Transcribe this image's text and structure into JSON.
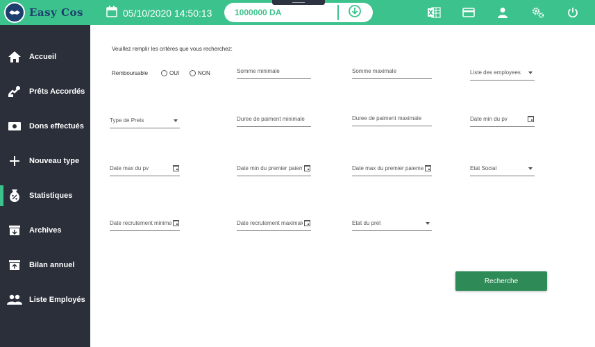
{
  "header": {
    "logo_text": "Easy Cos",
    "datetime": "05/10/2020 14:50:13",
    "balance": "1000000 DA",
    "icons": [
      "excel-icon",
      "credit-card-icon",
      "user-icon",
      "settings-icon",
      "power-icon"
    ]
  },
  "sidebar": {
    "items": [
      {
        "label": "Accueil",
        "icon": "home-icon"
      },
      {
        "label": "Prêts Accordés",
        "icon": "loan-icon"
      },
      {
        "label": "Dons effectués",
        "icon": "money-icon"
      },
      {
        "label": "Nouveau type",
        "icon": "plus-icon"
      },
      {
        "label": "Statistiques",
        "icon": "stats-icon"
      },
      {
        "label": "Archives",
        "icon": "archive-icon"
      },
      {
        "label": "Bilan annuel",
        "icon": "bilan-icon"
      },
      {
        "label": "Liste Employés",
        "icon": "people-icon"
      }
    ],
    "active_index": 4
  },
  "form": {
    "intro": "Veuillez remplir les critères que vous recherchez:",
    "remboursable_label": "Remboursable",
    "radio_oui": "OUI",
    "radio_non": "NON",
    "somme_min": "Somme minimale",
    "somme_max": "Somme maximale",
    "liste_employes": "Liste des employees",
    "type_prets": "Type de Prets",
    "duree_min": "Duree de paiment minimale",
    "duree_max": "Duree de paiment maximale",
    "date_min_pv": "Date min du pv",
    "date_max_pv": "Date max du pv",
    "date_min_premier": "Date min du premier paiement",
    "date_max_premier": "Date max du premier paiement",
    "etat_social": "Etat Social",
    "date_recrut_min": "Date recrutement minimale",
    "date_recrut_max": "Date recrutement maximale",
    "etat_pret": "Etat du pret",
    "search_button": "Recherche"
  },
  "colors": {
    "accent": "#3cc28c",
    "sidebar": "#2b2f3a",
    "button": "#2e8b57",
    "logo_navy": "#1e3f6e"
  }
}
